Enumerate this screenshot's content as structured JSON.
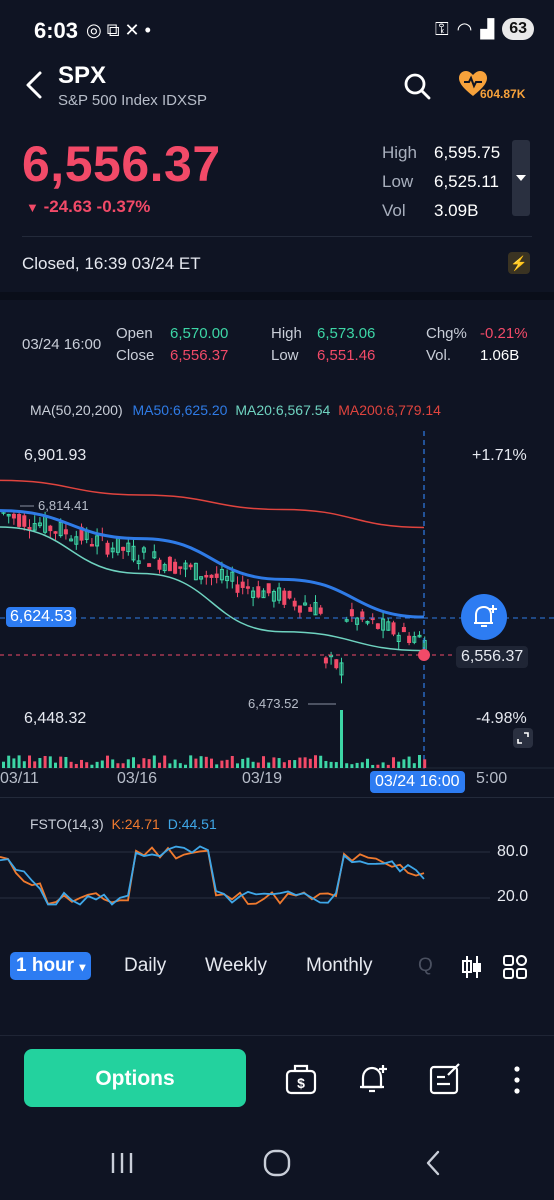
{
  "status_bar": {
    "time": "6:03",
    "battery": "63"
  },
  "header": {
    "symbol": "SPX",
    "subtitle": "S&P 500 Index IDXSP",
    "follower_count": "604.87K"
  },
  "quote": {
    "price": "6,556.37",
    "change": "-24.63 -0.37%",
    "high_label": "High",
    "high_value": "6,595.75",
    "low_label": "Low",
    "low_value": "6,525.11",
    "vol_label": "Vol",
    "vol_value": "3.09B",
    "closed_text": "Closed, 16:39 03/24 ET"
  },
  "ohlc": {
    "datetime": "03/24 16:00",
    "open_label": "Open",
    "open_value": "6,570.00",
    "close_label": "Close",
    "close_value": "6,556.37",
    "high_label": "High",
    "high_value": "6,573.06",
    "low_label": "Low",
    "low_value": "6,551.46",
    "chg_label": "Chg%",
    "chg_value": "-0.21%",
    "vol_label": "Vol.",
    "vol_value": "1.06B"
  },
  "ma_legend": {
    "label": "MA(50,20,200)",
    "ma50": "MA50:6,625.20",
    "ma20": "MA20:6,567.54",
    "ma200": "MA200:6,779.14",
    "colors": {
      "ma50": "#2f7be6",
      "ma20": "#6fd3c0",
      "ma200": "#e0443e"
    }
  },
  "price_chart": {
    "top_price": "6,901.93",
    "top_pct": "+1.71%",
    "bottom_price": "6,448.32",
    "bottom_pct": "-4.98%",
    "crosshair_price": "6,624.53",
    "last_price_tag": "6,556.37",
    "high_marker": "6,814.41",
    "low_marker": "6,473.52",
    "x_labels": [
      "03/11",
      "03/16",
      "03/19",
      "5:00"
    ],
    "crosshair_time": "03/24 16:00"
  },
  "chart_data": {
    "type": "line",
    "ma200_series": {
      "x": [
        "03/11",
        "03/16",
        "03/19",
        "03/24"
      ],
      "values": [
        6860,
        6835,
        6810,
        6779.14
      ]
    },
    "ma50_series": {
      "x": [
        "03/11",
        "03/16",
        "03/19",
        "03/24"
      ],
      "values": [
        6808,
        6760,
        6690,
        6625.2
      ]
    },
    "ma20_series": {
      "x": [
        "03/11",
        "03/16",
        "03/19",
        "03/24"
      ],
      "values": [
        6780,
        6700,
        6600,
        6567.54
      ]
    }
  },
  "oscillator": {
    "label": "FSTO(14,3)",
    "k": "K:24.71",
    "d": "D:44.51",
    "level_high": "80.0",
    "level_low": "20.0"
  },
  "timeframes": {
    "active": "1 hour",
    "items": [
      "Daily",
      "Weekly",
      "Monthly",
      "Q"
    ]
  },
  "bottom_bar": {
    "options_label": "Options"
  },
  "colors": {
    "up": "#3dd6a6",
    "down": "#f24a68",
    "accent": "#2d7cf2",
    "options": "#23d29e"
  }
}
